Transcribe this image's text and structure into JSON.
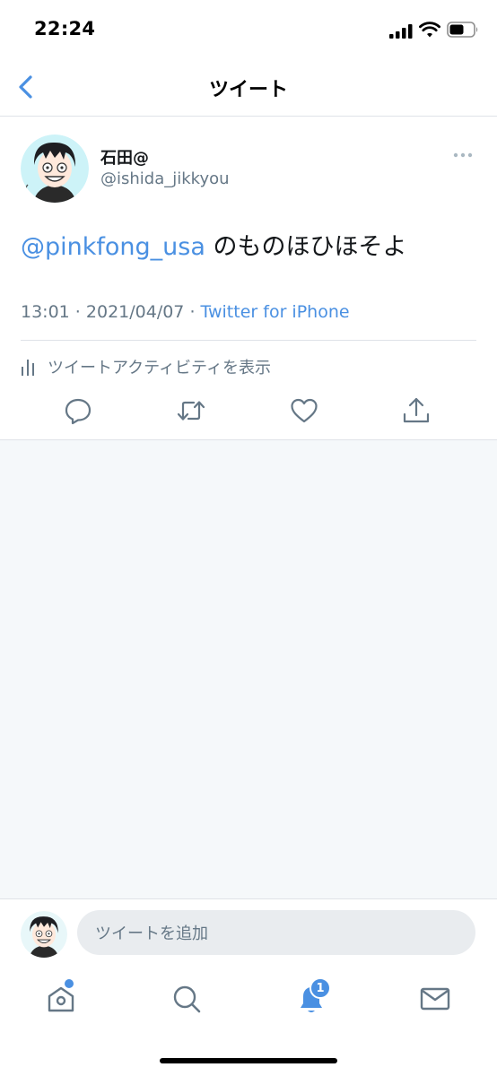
{
  "status_bar": {
    "time": "22:24"
  },
  "nav": {
    "title": "ツイート",
    "back_icon": "chevron-left-icon"
  },
  "tweet": {
    "author": {
      "display_name": "石田@",
      "handle": "@ishida_jikkyou"
    },
    "mention": "@pinkfong_usa",
    "text": " のものほひほそよ",
    "time": "13:01",
    "separator": " · ",
    "date": "2021/04/07",
    "separator2": " · ",
    "client": "Twitter for iPhone",
    "activity_label": "ツイートアクティビティを表示",
    "actions": [
      "reply-icon",
      "retweet-icon",
      "like-icon",
      "share-icon"
    ]
  },
  "reply_bar": {
    "placeholder": "ツイートを追加"
  },
  "tab_bar": {
    "tabs": [
      "home-icon",
      "search-icon",
      "notifications-icon",
      "messages-icon"
    ],
    "notification_count": "1"
  },
  "colors": {
    "accent": "#4a90e2",
    "secondary_text": "#657786",
    "background_gray": "#f5f8fa"
  }
}
